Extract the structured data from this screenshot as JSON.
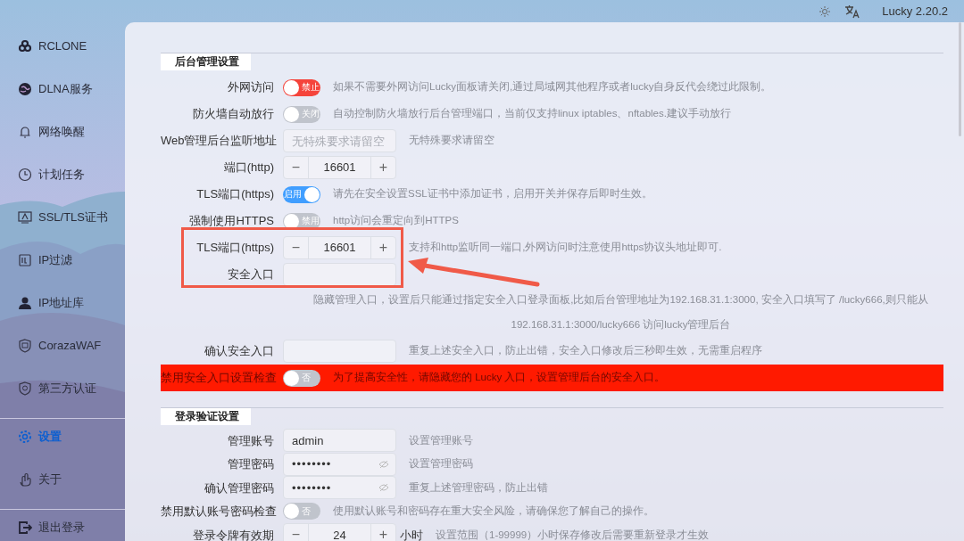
{
  "top_bar": {
    "version": "Lucky 2.20.2"
  },
  "sidebar": {
    "items": [
      {
        "label": "RCLONE",
        "selected": false
      },
      {
        "label": "DLNA服务",
        "selected": false
      },
      {
        "label": "网络唤醒",
        "selected": false
      },
      {
        "label": "计划任务",
        "selected": false
      },
      {
        "label": "SSL/TLS证书",
        "selected": false
      },
      {
        "label": "IP过滤",
        "selected": false
      },
      {
        "label": "IP地址库",
        "selected": false
      },
      {
        "label": "CorazaWAF",
        "selected": false
      },
      {
        "label": "第三方认证",
        "selected": false
      },
      {
        "label": "设置",
        "selected": true
      },
      {
        "label": "关于",
        "selected": false
      },
      {
        "label": "退出登录",
        "selected": false
      }
    ]
  },
  "sections": [
    {
      "title": "后台管理设置",
      "rows": [
        {
          "kind": "toggle",
          "label": "外网访问",
          "toggle": {
            "text": "禁止",
            "on": false,
            "kind": "danger"
          },
          "desc": "如果不需要外网访问Lucky面板请关闭,通过局域网其他程序或者lucky自身反代会绕过此限制。",
          "alert": false
        },
        {
          "kind": "toggle",
          "label": "防火墙自动放行",
          "toggle": {
            "text": "关闭",
            "on": false,
            "kind": "normal"
          },
          "desc": "自动控制防火墙放行后台管理端口，当前仅支持linux iptables、nftables.建议手动放行",
          "alert": false
        },
        {
          "kind": "input",
          "label": "Web管理后台监听地址",
          "placeholder": "无特殊要求请留空",
          "desc": "无特殊要求请留空",
          "alert": false
        },
        {
          "kind": "stepper",
          "label": "端口(http)",
          "minus": "−",
          "value": "16601",
          "plus": "+",
          "alert": false
        },
        {
          "kind": "toggle",
          "label": "TLS端口(https)",
          "toggle": {
            "text": "启用",
            "on": true,
            "kind": "normal"
          },
          "desc": "请先在安全设置SSL证书中添加证书，启用开关并保存后即时生效。",
          "alert": false
        },
        {
          "kind": "toggle",
          "label": "强制使用HTTPS",
          "toggle": {
            "text": "禁用",
            "on": false,
            "kind": "normal"
          },
          "desc": "http访问会重定向到HTTPS",
          "alert": false
        },
        {
          "kind": "stepper",
          "label": "TLS端口(https)",
          "minus": "−",
          "value": "16601",
          "plus": "+",
          "desc": "支持和http监听同一端口,外网访问时注意使用https协议头地址即可.",
          "alert": false
        },
        {
          "kind": "input",
          "label": "安全入口",
          "alert": false
        },
        {
          "kind": "note",
          "lines": [
            "隐藏管理入口，设置后只能通过指定安全入口登录面板,比如后台管理地址为192.168.31.1:3000, 安全入口填写了 /lucky666,则只能从",
            "192.168.31.1:3000/lucky666 访问lucky管理后台"
          ],
          "alert": false
        },
        {
          "kind": "input",
          "label": "确认安全入口",
          "desc": "重复上述安全入口，防止出错，安全入口修改后三秒即生效，无需重启程序",
          "alert": false
        },
        {
          "kind": "toggle",
          "label": "禁用安全入口设置检查",
          "toggle": {
            "text": "否",
            "on": false,
            "kind": "normal"
          },
          "desc": "为了提高安全性，请隐藏您的 Lucky 入口，设置管理后台的安全入口。",
          "alert": true
        }
      ]
    },
    {
      "title": "登录验证设置",
      "rows": [
        {
          "kind": "input",
          "label": "管理账号",
          "value": "admin",
          "desc": "设置管理账号",
          "alert": false
        },
        {
          "kind": "password",
          "label": "管理密码",
          "value": "••••••••",
          "desc": "设置管理密码",
          "alert": false
        },
        {
          "kind": "password",
          "label": "确认管理密码",
          "value": "••••••••",
          "desc": "重复上述管理密码，防止出错",
          "alert": false
        },
        {
          "kind": "toggle",
          "label": "禁用默认账号密码检查",
          "toggle": {
            "text": "否",
            "on": false,
            "kind": "normal"
          },
          "desc": "使用默认账号和密码存在重大安全风险，请确保您了解自己的操作。",
          "alert": false
        },
        {
          "kind": "stepper",
          "label": "登录令牌有效期",
          "minus": "−",
          "value": "24",
          "plus": "+",
          "unit": "小时",
          "desc": "设置范围（1-99999）小时保存修改后需要重新登录才生效",
          "alert": false
        }
      ]
    }
  ]
}
